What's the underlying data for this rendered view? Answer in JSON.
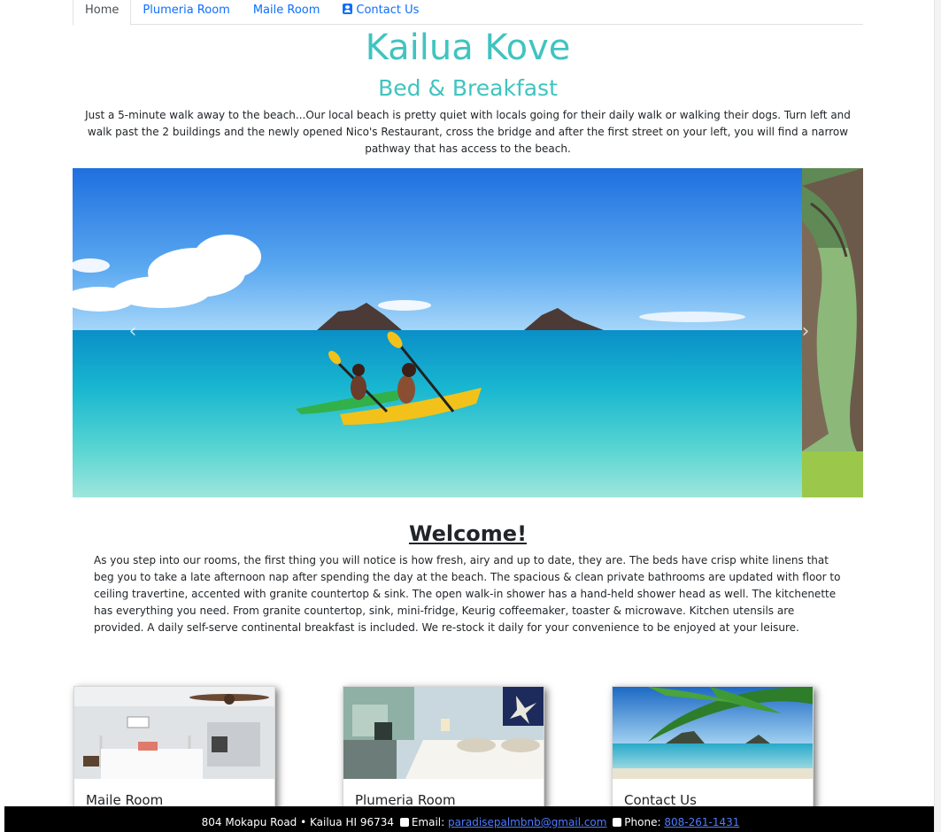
{
  "nav": {
    "tabs": [
      {
        "label": "Home",
        "active": true
      },
      {
        "label": "Plumeria Room"
      },
      {
        "label": "Maile Room"
      },
      {
        "label": "Contact Us",
        "icon": "contact-card-icon"
      }
    ]
  },
  "header": {
    "title": "Kailua Kove",
    "subtitle": "Bed & Breakfast",
    "intro": "Just a 5-minute walk away to the beach...Our local beach is pretty quiet with locals going for their daily walk or walking their dogs. Turn left and walk past the 2 buildings and the newly opened Nico's Restaurant, cross the bridge and after the first street on your left, you will find a narrow pathway that has access to the beach."
  },
  "carousel": {
    "prev_icon": "chevron-left-icon",
    "next_icon": "chevron-right-icon",
    "prev_glyph": "‹",
    "next_glyph": "›"
  },
  "welcome": {
    "heading": "Welcome!",
    "body": "As you step into our rooms, the first thing you will notice is how fresh, airy and up to date, they are. The beds have crisp white linens that beg you to take a late afternoon nap after spending the day at the beach. The spacious & clean private bathrooms are updated with floor to ceiling travertine, accented with granite countertop & sink. The open walk-in shower has a hand-held shower head as well. The kitchenette has everything you need. From granite countertop, sink, mini-fridge, Keurig coffeemaker, toaster & microwave. Kitchen utensils are provided. A daily self-serve continental breakfast is included. We re-stock it daily for your convenience to be enjoyed at your leisure."
  },
  "cards": [
    {
      "title": "Maile Room"
    },
    {
      "title": "Plumeria Room"
    },
    {
      "title": "Contact Us"
    }
  ],
  "footer": {
    "address": "804 Mokapu Road • Kailua HI 96734",
    "email_label": "Email:",
    "email": "paradisepalmbnb@gmail.com",
    "phone_label": "Phone:",
    "phone": "808-261-1431"
  },
  "colors": {
    "accent": "#40c4c0",
    "link": "#0d6efd",
    "footer_bg": "#000000"
  }
}
